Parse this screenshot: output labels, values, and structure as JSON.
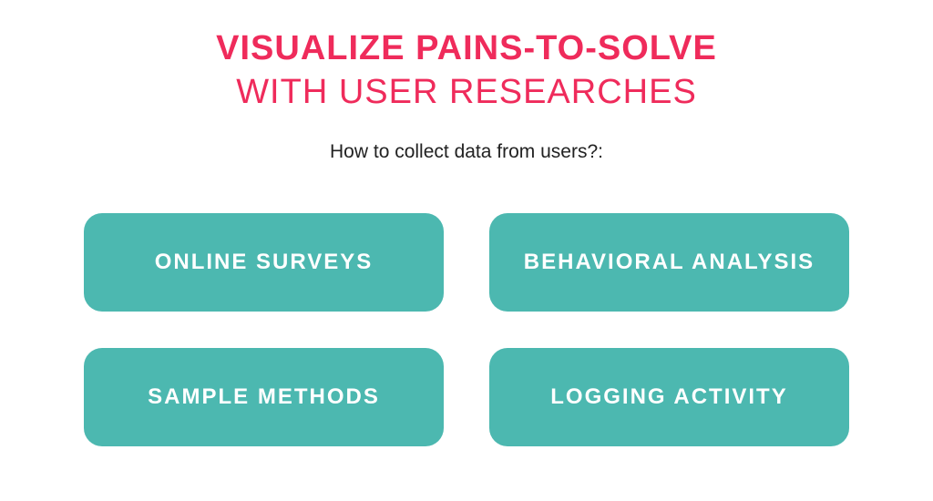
{
  "heading": {
    "line1": "VISUALIZE PAINS-TO-SOLVE",
    "line2": "WITH USER RESEARCHES"
  },
  "subtitle": "How to collect data from users?:",
  "cards": {
    "0": "ONLINE SURVEYS",
    "1": "BEHAVIORAL ANALYSIS",
    "2": "SAMPLE METHODS",
    "3": "LOGGING ACTIVITY"
  },
  "colors": {
    "accent": "#ef2b5b",
    "card": "#4cb8b0"
  }
}
